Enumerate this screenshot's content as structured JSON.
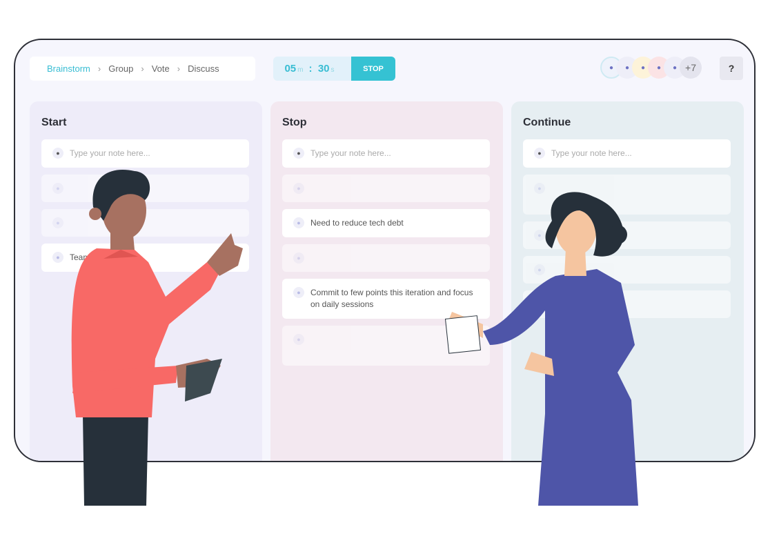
{
  "steps": [
    "Brainstorm",
    "Group",
    "Vote",
    "Discuss"
  ],
  "timer": {
    "minutes": "05",
    "m_unit": "m",
    "seconds": "30",
    "s_unit": "s",
    "stop_label": "STOP"
  },
  "avatars": [
    {
      "icon": "crab-icon",
      "color": "#eef2fb"
    },
    {
      "icon": "elephant-icon",
      "color": "#eeeef8"
    },
    {
      "icon": "fish-icon",
      "color": "#fdf3d9"
    },
    {
      "icon": "jellyfish-icon",
      "color": "#fbe3e5"
    },
    {
      "icon": "koala-icon",
      "color": "#eeeef8"
    }
  ],
  "avatar_more": "+7",
  "help_label": "?",
  "placeholder": "Type your note here...",
  "columns": [
    {
      "title": "Start",
      "bg": "#eeecf9",
      "notes": [
        {
          "text": "",
          "faded": true
        },
        {
          "text": "",
          "faded": true
        },
        {
          "text": "Team",
          "text2": "on"
        }
      ]
    },
    {
      "title": "Stop",
      "bg": "#f3e8f0",
      "notes": [
        {
          "text": "",
          "faded": true
        },
        {
          "text": "Need to reduce tech debt"
        },
        {
          "text": "",
          "faded": true
        },
        {
          "text": "Commit to few points this iteration and focus on daily sessions"
        },
        {
          "text": "",
          "faded": true
        }
      ]
    },
    {
      "title": "Continue",
      "bg": "#e6eef2",
      "notes": [
        {
          "text": "",
          "faded": true
        },
        {
          "text": "",
          "faded": true
        },
        {
          "text": "",
          "faded": true
        },
        {
          "text": "",
          "faded": true
        }
      ]
    }
  ],
  "colors": {
    "accent": "#35c2d3",
    "frame": "#2d2f37"
  }
}
